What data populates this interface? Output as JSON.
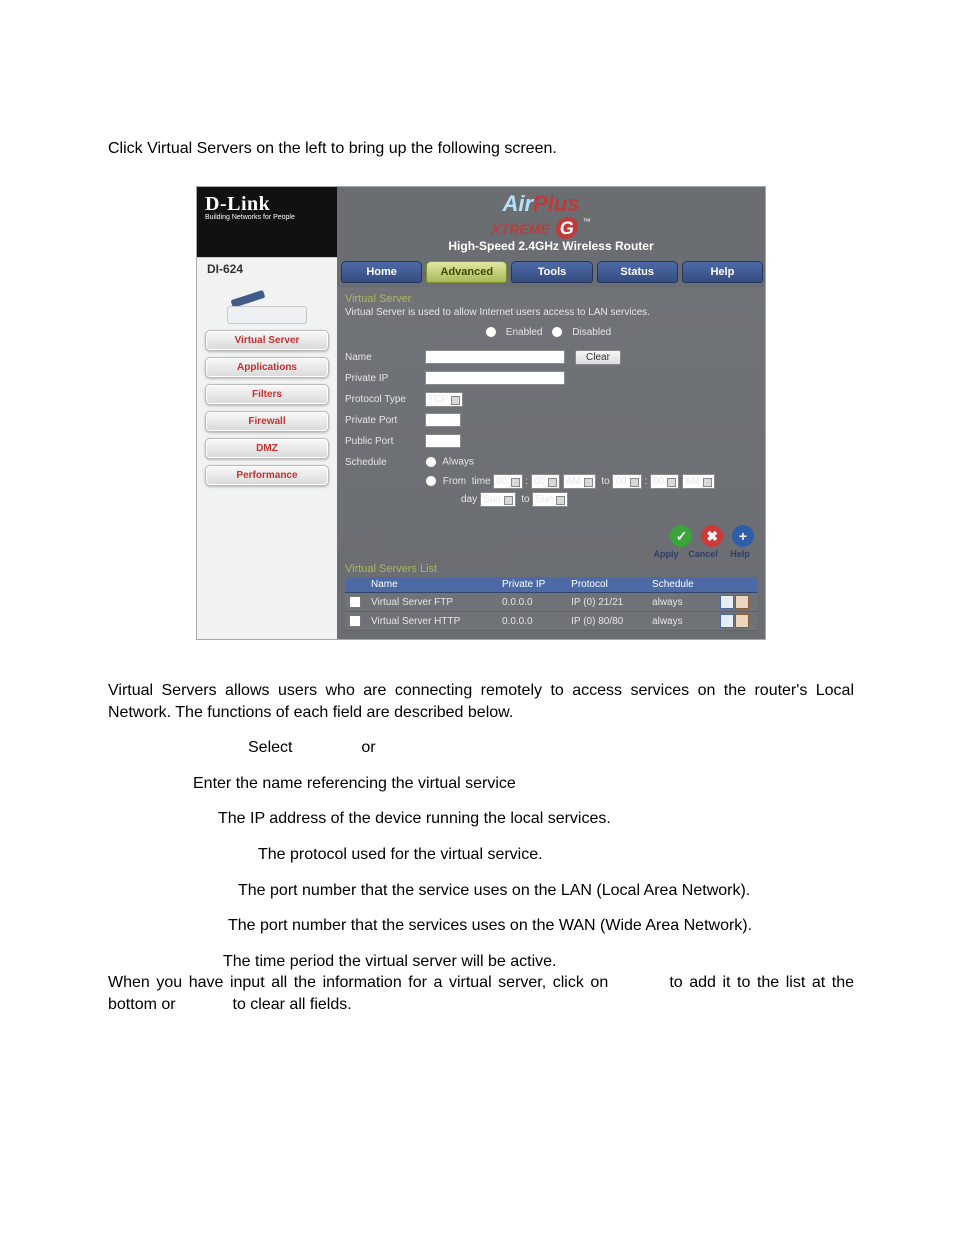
{
  "intro": "Click Virtual Servers on the left to bring up the following screen.",
  "brand": {
    "logo": "D-Link",
    "tagline": "Building Networks for People",
    "airplus_air": "Air",
    "airplus_plus": "Plus",
    "xtreme": "XTREME",
    "g": "G",
    "tm": "™",
    "subtitle": "High-Speed 2.4GHz Wireless Router"
  },
  "model": "DI-624",
  "sidebar": {
    "items": [
      {
        "label": "Virtual Server"
      },
      {
        "label": "Applications"
      },
      {
        "label": "Filters"
      },
      {
        "label": "Firewall"
      },
      {
        "label": "DMZ"
      },
      {
        "label": "Performance"
      }
    ]
  },
  "tabs": [
    {
      "label": "Home"
    },
    {
      "label": "Advanced"
    },
    {
      "label": "Tools"
    },
    {
      "label": "Status"
    },
    {
      "label": "Help"
    }
  ],
  "panel": {
    "title": "Virtual Server",
    "desc": "Virtual Server is used to allow Internet users access to LAN services.",
    "enabled": "Enabled",
    "disabled": "Disabled",
    "fields": {
      "name": "Name",
      "private_ip": "Private IP",
      "protocol_type": "Protocol Type",
      "protocol_value": "TCP",
      "private_port": "Private Port",
      "public_port": "Public Port",
      "schedule": "Schedule",
      "always": "Always",
      "from": "From",
      "time": "time",
      "to": "to",
      "day": "day",
      "hour": "00",
      "min": "00",
      "ampm": "AM",
      "dow": "Sun"
    },
    "clear": "Clear",
    "actions": {
      "apply": "Apply",
      "cancel": "Cancel",
      "help": "Help"
    }
  },
  "vslist": {
    "title": "Virtual Servers List",
    "cols": {
      "name": "Name",
      "private_ip": "Private IP",
      "protocol": "Protocol",
      "schedule": "Schedule"
    },
    "rows": [
      {
        "name": "Virtual Server FTP",
        "ip": "0.0.0.0",
        "proto": "IP (0) 21/21",
        "sched": "always"
      },
      {
        "name": "Virtual Server HTTP",
        "ip": "0.0.0.0",
        "proto": "IP (0) 80/80",
        "sched": "always"
      }
    ]
  },
  "explain": {
    "para1": "Virtual Servers allows users who are connecting remotely to access services on the router's Local Network. The functions of each field are described below.",
    "select_or": {
      "select": "Select",
      "or": "or"
    },
    "name": "Enter the name referencing the virtual service",
    "private_ip": "The IP address of the device running the local services.",
    "protocol_type": "The protocol used for the virtual service.",
    "private_port": "The port number that the service uses on the LAN (Local Area Network).",
    "public_port": "The port number that the services uses on the WAN (Wide Area Network).",
    "schedule": "The time period the virtual server will be active.",
    "closing_a": "When you have input all the information for a virtual server, click on",
    "closing_b": "to add it to the list at the bottom or",
    "closing_c": "to clear all fields."
  }
}
